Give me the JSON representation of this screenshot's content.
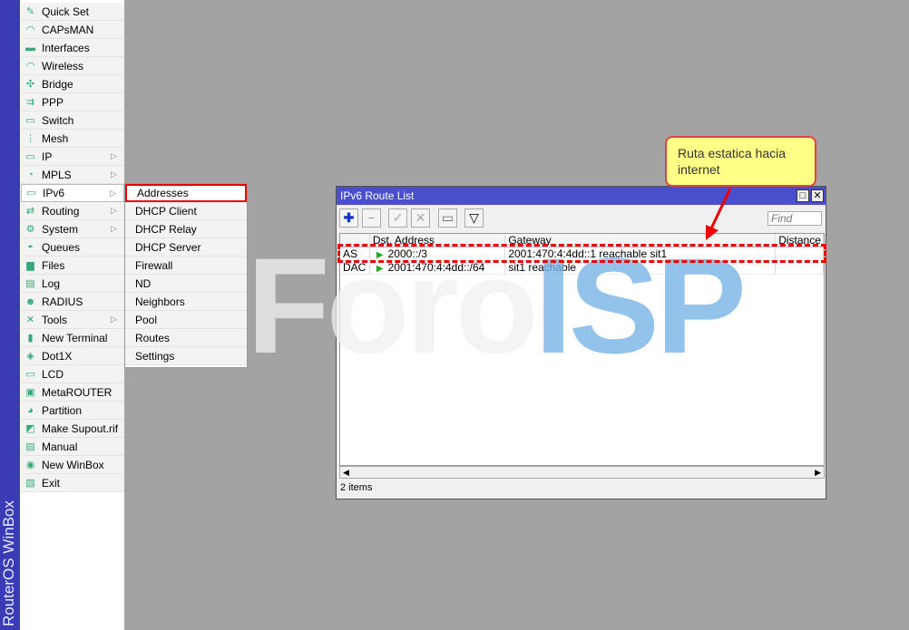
{
  "sidebar": {
    "brand": "RouterOS WinBox",
    "items": [
      {
        "label": "Quick Set",
        "icon": "wand-icon",
        "g": "✎"
      },
      {
        "label": "CAPsMAN",
        "icon": "antenna-icon",
        "g": "◠"
      },
      {
        "label": "Interfaces",
        "icon": "interfaces-icon",
        "g": "▬"
      },
      {
        "label": "Wireless",
        "icon": "wireless-icon",
        "g": "◠"
      },
      {
        "label": "Bridge",
        "icon": "bridge-icon",
        "g": "✣"
      },
      {
        "label": "PPP",
        "icon": "ppp-icon",
        "g": "⇉"
      },
      {
        "label": "Switch",
        "icon": "switch-icon",
        "g": "▭"
      },
      {
        "label": "Mesh",
        "icon": "mesh-icon",
        "g": "⋮"
      },
      {
        "label": "IP",
        "icon": "ip-icon",
        "g": "▭",
        "sub": true
      },
      {
        "label": "MPLS",
        "icon": "mpls-icon",
        "g": "◔",
        "sub": true
      },
      {
        "label": "IPv6",
        "icon": "ipv6-icon",
        "g": "▭",
        "sub": true,
        "sel": true
      },
      {
        "label": "Routing",
        "icon": "routing-icon",
        "g": "⇄",
        "sub": true
      },
      {
        "label": "System",
        "icon": "gear-icon",
        "g": "⚙",
        "sub": true
      },
      {
        "label": "Queues",
        "icon": "queues-icon",
        "g": "◓"
      },
      {
        "label": "Files",
        "icon": "folder-icon",
        "g": "▆"
      },
      {
        "label": "Log",
        "icon": "log-icon",
        "g": "▤"
      },
      {
        "label": "RADIUS",
        "icon": "radius-icon",
        "g": "☻"
      },
      {
        "label": "Tools",
        "icon": "tools-icon",
        "g": "✕",
        "sub": true
      },
      {
        "label": "New Terminal",
        "icon": "terminal-icon",
        "g": "▮"
      },
      {
        "label": "Dot1X",
        "icon": "dot1x-icon",
        "g": "◈"
      },
      {
        "label": "LCD",
        "icon": "lcd-icon",
        "g": "▭"
      },
      {
        "label": "MetaROUTER",
        "icon": "metarouter-icon",
        "g": "▣"
      },
      {
        "label": "Partition",
        "icon": "partition-icon",
        "g": "◕"
      },
      {
        "label": "Make Supout.rif",
        "icon": "supout-icon",
        "g": "◩"
      },
      {
        "label": "Manual",
        "icon": "manual-icon",
        "g": "▤"
      },
      {
        "label": "New WinBox",
        "icon": "winbox-icon",
        "g": "◉"
      },
      {
        "label": "Exit",
        "icon": "exit-icon",
        "g": "▧"
      }
    ]
  },
  "submenu": {
    "items": [
      "Addresses",
      "DHCP Client",
      "DHCP Relay",
      "DHCP Server",
      "Firewall",
      "ND",
      "Neighbors",
      "Pool",
      "Routes",
      "Settings"
    ]
  },
  "window": {
    "title": "IPv6 Route List",
    "find_placeholder": "Find",
    "columns": [
      "",
      "Dst. Address",
      "Gateway",
      "Distance"
    ],
    "rows": [
      {
        "flags": "AS",
        "dst": "2000::/3",
        "gateway": "2001:470:4:4dd::1 reachable sit1"
      },
      {
        "flags": "DAC",
        "dst": "2001:470:4:4dd::/64",
        "gateway": "sit1 reachable"
      }
    ],
    "status": "2 items"
  },
  "watermark": "ForoISP",
  "callout": "Ruta estatica hacia internet",
  "colors": {
    "highlight": "#ee0000",
    "titlebar": "#4a4fcc",
    "callout_bg": "#ffff88"
  }
}
